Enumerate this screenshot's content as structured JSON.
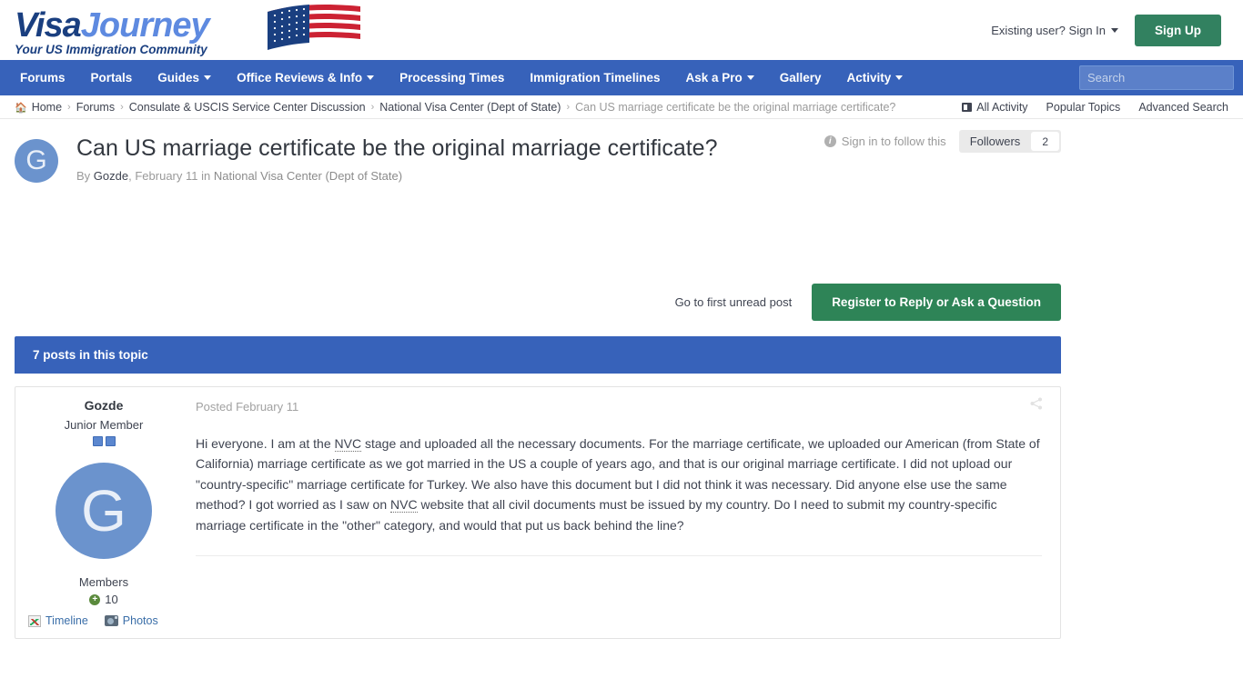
{
  "header": {
    "logo": {
      "part1": "Visa",
      "part2": "Journey",
      "tagline": "Your US Immigration Community",
      "flag_icon": "us-flag-icon"
    },
    "signin_label": "Existing user? Sign In",
    "signup_label": "Sign Up",
    "accent_green": "#328160",
    "accent_blue": "#3762ba"
  },
  "nav": {
    "items": [
      {
        "label": "Forums",
        "caret": false
      },
      {
        "label": "Portals",
        "caret": false
      },
      {
        "label": "Guides",
        "caret": true
      },
      {
        "label": "Office Reviews & Info",
        "caret": true
      },
      {
        "label": "Processing Times",
        "caret": false
      },
      {
        "label": "Immigration Timelines",
        "caret": false
      },
      {
        "label": "Ask a Pro",
        "caret": true
      },
      {
        "label": "Gallery",
        "caret": false
      },
      {
        "label": "Activity",
        "caret": true
      }
    ],
    "search_placeholder": "Search",
    "search_value": ""
  },
  "breadcrumb": {
    "home_label": "Home",
    "items": [
      "Forums",
      "Consulate & USCIS Service Center Discussion",
      "National Visa Center (Dept of State)"
    ],
    "current": "Can US marriage certificate be the original marriage certificate?",
    "separator": "›",
    "right_links": [
      "All Activity",
      "Popular Topics",
      "Advanced Search"
    ]
  },
  "topic": {
    "avatar_letter": "G",
    "title": "Can US marriage certificate be the original marriage certificate?",
    "by_prefix": "By",
    "author": "Gozde",
    "date": "February 11",
    "in_word": "in",
    "forum": "National Visa Center (Dept of State)",
    "follow_note": "Sign in to follow this",
    "followers_label": "Followers",
    "followers_count": "2"
  },
  "actions": {
    "unread_label": "Go to first unread post",
    "register_label": "Register to Reply or Ask a Question"
  },
  "posts_section": {
    "header_label": "7 posts in this topic"
  },
  "post": {
    "user": {
      "name": "Gozde",
      "rank": "Junior Member",
      "rank_pips": 2,
      "avatar_letter": "G",
      "group": "Members",
      "reputation": "10",
      "links": [
        {
          "label": "Timeline",
          "icon": "timeline-icon"
        },
        {
          "label": "Photos",
          "icon": "photos-icon"
        }
      ]
    },
    "posted_label": "Posted February 11",
    "share_icon": "share-icon",
    "body_parts": {
      "p1": "Hi everyone. I am at the ",
      "abbr1": "NVC",
      "p2": " stage and uploaded all the necessary documents. For the marriage certificate, we uploaded our American (from State of California) marriage certificate as we got married in the US a couple of years ago, and that is our original marriage certificate. I did not upload our \"country-specific\" marriage certificate for Turkey. We also have this document but I did not think it was necessary. Did anyone else use the same method? I got worried as I saw on ",
      "abbr2": "NVC",
      "p3": " website that all civil documents must be issued by my country. Do I need to submit my country-specific marriage certificate in the \"other\" category, and would that put us back behind the line?"
    }
  }
}
